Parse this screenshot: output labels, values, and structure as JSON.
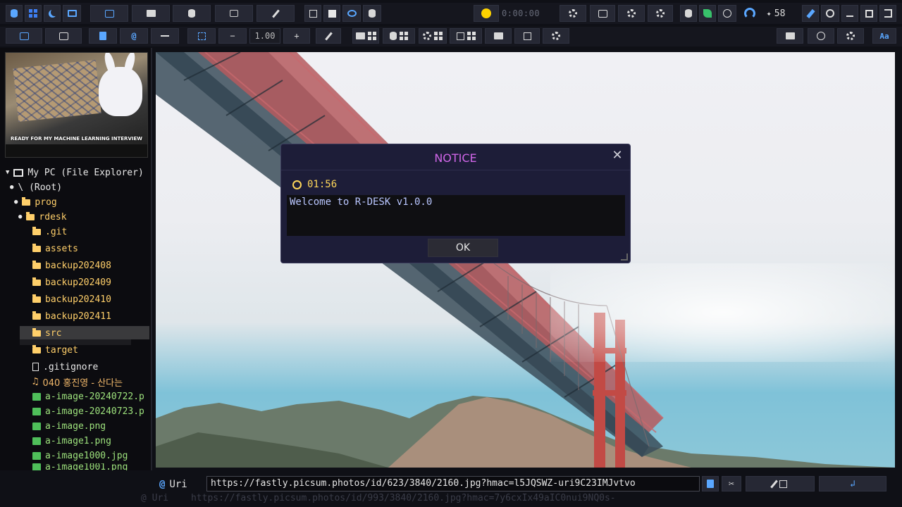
{
  "toolbar_top": {
    "timer": "0:00:00",
    "quote_count": "58"
  },
  "toolbar_second": {
    "zoom_value": "1.00",
    "zoom_minus": "−",
    "zoom_plus": "+"
  },
  "thumbnail": {
    "caption": "READY FOR MY MACHINE LEARNING INTERVIEW"
  },
  "tree": {
    "root_label": "My PC (File Explorer)",
    "items": [
      {
        "label": "\\ (Root)",
        "kind": "root"
      },
      {
        "label": "prog",
        "kind": "folder"
      },
      {
        "label": "rdesk",
        "kind": "folder"
      },
      {
        "label": ".git",
        "kind": "folder"
      },
      {
        "label": "assets",
        "kind": "folder"
      },
      {
        "label": "backup202408",
        "kind": "folder"
      },
      {
        "label": "backup202409",
        "kind": "folder"
      },
      {
        "label": "backup202410",
        "kind": "folder"
      },
      {
        "label": "backup202411",
        "kind": "folder"
      },
      {
        "label": "src",
        "kind": "folder"
      },
      {
        "label": "target",
        "kind": "folder"
      },
      {
        "label": ".gitignore",
        "kind": "file"
      },
      {
        "label": "040 홍진영 - 산다는",
        "kind": "music"
      },
      {
        "label": "a-image-20240722.p",
        "kind": "image"
      },
      {
        "label": "a-image-20240723.p",
        "kind": "image"
      },
      {
        "label": "a-image.png",
        "kind": "image"
      },
      {
        "label": "a-image1.png",
        "kind": "image"
      },
      {
        "label": "a-image1000.jpg",
        "kind": "image"
      },
      {
        "label": "a-image1001.png",
        "kind": "image"
      }
    ]
  },
  "dialog": {
    "title": "NOTICE",
    "close": "✕",
    "clock_time": "01:56",
    "message": "Welcome to R-DESK v1.0.0",
    "ok_label": "OK"
  },
  "statusbar": {
    "uri_label": "Uri",
    "uri_at": "@",
    "uri_value": "https://fastly.picsum.photos/id/623/3840/2160.jpg?hmac=l5JQSWZ-uri9C23IMJvtvo"
  },
  "ghost": {
    "uri_label": "@ Uri",
    "uri_value": "https://fastly.picsum.photos/id/993/3840/2160.jpg?hmac=7y6cxIx49aIC0nui9NQ0s-"
  },
  "colors": {
    "accent": "#5aa7ff",
    "dialog_title": "#d066e8",
    "folder": "#ffcf6a",
    "image_file": "#9ee37d"
  }
}
